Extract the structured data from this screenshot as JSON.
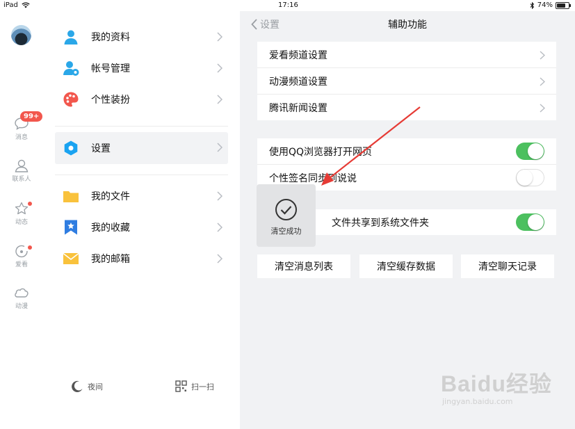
{
  "status_bar": {
    "device": "iPad",
    "time": "17:16",
    "battery": "74%",
    "battery_level": 0.74
  },
  "rail": {
    "badge": "99+",
    "items": [
      {
        "label": "消息",
        "icon": "chat-bubble-icon"
      },
      {
        "label": "联系人",
        "icon": "contact-icon"
      },
      {
        "label": "动态",
        "icon": "star-icon"
      },
      {
        "label": "爱看",
        "icon": "watch-icon"
      },
      {
        "label": "动漫",
        "icon": "cloud-icon"
      }
    ]
  },
  "menu": {
    "items": [
      {
        "label": "我的资料",
        "icon": "person-icon",
        "color": "#2aa7e8"
      },
      {
        "label": "帐号管理",
        "icon": "account-manage-icon",
        "color": "#2aa7e8"
      },
      {
        "label": "个性装扮",
        "icon": "palette-icon",
        "color": "#f2574d"
      },
      {
        "label": "设置",
        "icon": "settings-hexagon-icon",
        "color": "#1aa3f1"
      },
      {
        "label": "我的文件",
        "icon": "folder-icon",
        "color": "#f9c23c"
      },
      {
        "label": "我的收藏",
        "icon": "bookmark-star-icon",
        "color": "#2f7de1"
      },
      {
        "label": "我的邮箱",
        "icon": "mail-icon",
        "color": "#f9c23c"
      }
    ],
    "night_label": "夜间",
    "scan_label": "扫一扫"
  },
  "panel": {
    "back_label": "设置",
    "title": "辅助功能",
    "group1": [
      "爱看频道设置",
      "动漫频道设置",
      "腾讯新闻设置"
    ],
    "group2": [
      {
        "label": "使用QQ浏览器打开网页",
        "on": true
      },
      {
        "label": "个性签名同步到说说",
        "on": false
      }
    ],
    "group3": {
      "label": "将文件共享到系统文件夹",
      "visible_label": "文件共享到系统文件夹",
      "on": true
    },
    "buttons": [
      "清空消息列表",
      "清空缓存数据",
      "清空聊天记录"
    ],
    "toast": "清空成功",
    "toggle_on_color": "#4cc05f"
  },
  "watermark": {
    "brand": "Baidu经验",
    "url": "jingyan.baidu.com"
  }
}
